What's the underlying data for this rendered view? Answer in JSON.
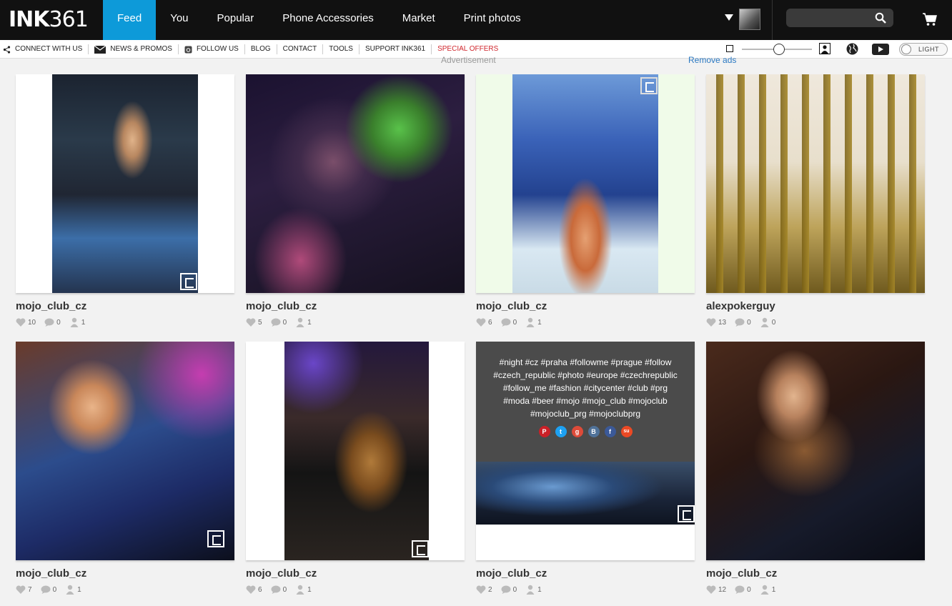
{
  "app": {
    "logo_bold": "INK",
    "logo_thin": "361"
  },
  "nav": {
    "items": [
      {
        "label": "Feed",
        "active": true
      },
      {
        "label": "You"
      },
      {
        "label": "Popular"
      },
      {
        "label": "Phone Accessories"
      },
      {
        "label": "Market"
      },
      {
        "label": "Print photos"
      }
    ]
  },
  "subnav": {
    "links": [
      {
        "label": "Connect with us",
        "icon": "share-icon"
      },
      {
        "label": "News & Promos",
        "icon": "envelope-icon"
      },
      {
        "label": "Follow us",
        "icon": "instagram-icon"
      },
      {
        "label": "Blog"
      },
      {
        "label": "Contact"
      },
      {
        "label": "Tools"
      },
      {
        "label": "Support INK361"
      },
      {
        "label": "Special offers",
        "special": true
      }
    ],
    "light_label": "LIGHT",
    "zoom_level": 0.55
  },
  "ad": {
    "label": "Advertisement",
    "remove": "Remove ads"
  },
  "colors": {
    "accent": "#0d9ad9",
    "special": "#d0262c"
  },
  "posts": [
    {
      "user": "mojo_club_cz",
      "likes": "10",
      "comments": "0",
      "followers": "1"
    },
    {
      "user": "mojo_club_cz",
      "likes": "5",
      "comments": "0",
      "followers": "1"
    },
    {
      "user": "mojo_club_cz",
      "likes": "6",
      "comments": "0",
      "followers": "1"
    },
    {
      "user": "alexpokerguy",
      "likes": "13",
      "comments": "0",
      "followers": "0"
    },
    {
      "user": "mojo_club_cz",
      "likes": "7",
      "comments": "0",
      "followers": "1"
    },
    {
      "user": "mojo_club_cz",
      "likes": "6",
      "comments": "0",
      "followers": "1"
    },
    {
      "user": "mojo_club_cz",
      "likes": "2",
      "comments": "0",
      "followers": "1",
      "caption": "#night #cz #praha #followme #prague #follow #czech_republic #photo #europe #czechrepublic #follow_me #fashion #citycenter #club #prg #moda #beer #mojo #mojo_club #mojoclub #mojoclub_prg #mojoclubprg"
    },
    {
      "user": "mojo_club_cz",
      "likes": "12",
      "comments": "0",
      "followers": "1"
    }
  ],
  "share": {
    "pinterest": "P",
    "twitter": "t",
    "google": "g",
    "vk": "B",
    "facebook": "f",
    "stumbleupon": "su"
  }
}
